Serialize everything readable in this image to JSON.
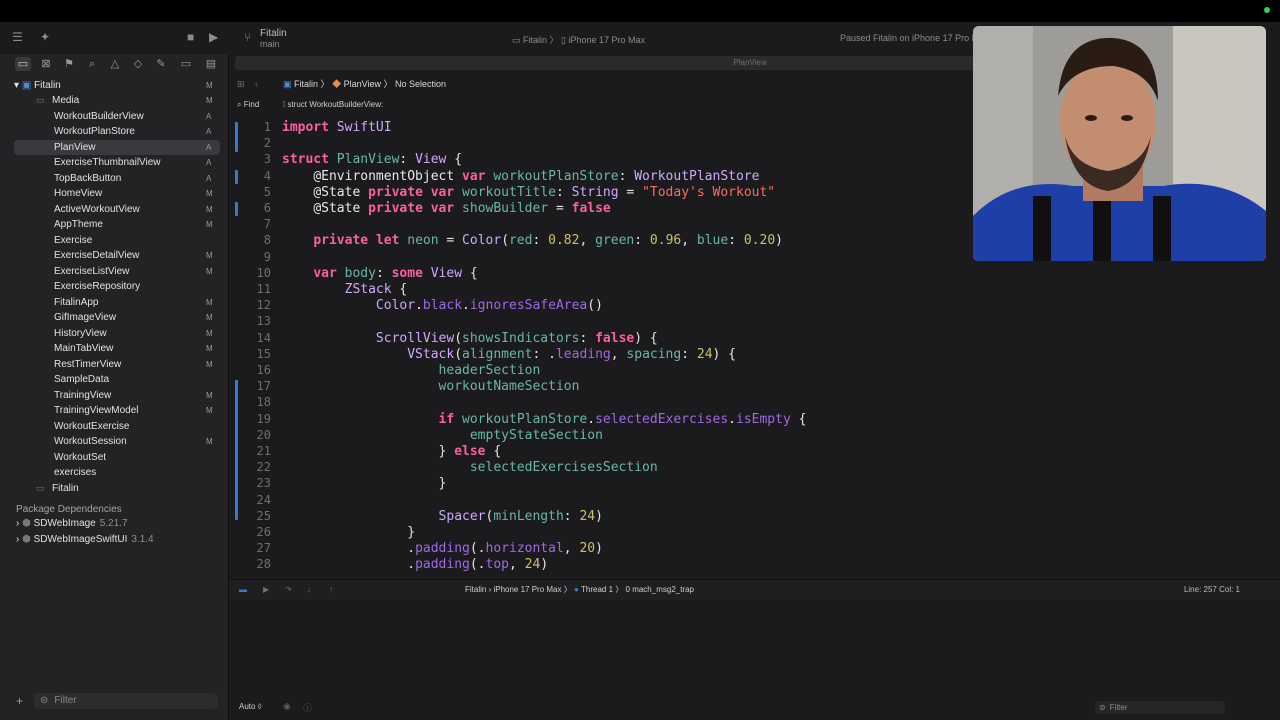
{
  "window": {
    "project_name": "Fitalin",
    "branch": "main",
    "scheme": "Fitalin",
    "device": "iPhone 17 Pro Max",
    "status": "Paused Fitalin on iPhone 17 Pro M"
  },
  "sidebar": {
    "root": {
      "name": "Fitalin",
      "status": "M"
    },
    "items": [
      {
        "name": "Media",
        "status": "M",
        "kind": "folder"
      },
      {
        "name": "WorkoutBuilderView",
        "status": "A"
      },
      {
        "name": "WorkoutPlanStore",
        "status": "A"
      },
      {
        "name": "PlanView",
        "status": "A",
        "selected": true
      },
      {
        "name": "ExerciseThumbnailView",
        "status": "A"
      },
      {
        "name": "TopBackButton",
        "status": "A"
      },
      {
        "name": "HomeView",
        "status": "M"
      },
      {
        "name": "ActiveWorkoutView",
        "status": "M"
      },
      {
        "name": "AppTheme",
        "status": "M"
      },
      {
        "name": "Exercise",
        "status": ""
      },
      {
        "name": "ExerciseDetailView",
        "status": "M"
      },
      {
        "name": "ExerciseListView",
        "status": "M"
      },
      {
        "name": "ExerciseRepository",
        "status": ""
      },
      {
        "name": "FitalinApp",
        "status": "M"
      },
      {
        "name": "GifImageView",
        "status": "M"
      },
      {
        "name": "HistoryView",
        "status": "M"
      },
      {
        "name": "MainTabView",
        "status": "M"
      },
      {
        "name": "RestTimerView",
        "status": "M"
      },
      {
        "name": "SampleData",
        "status": ""
      },
      {
        "name": "TrainingView",
        "status": "M"
      },
      {
        "name": "TrainingViewModel",
        "status": "M"
      },
      {
        "name": "WorkoutExercise",
        "status": ""
      },
      {
        "name": "WorkoutSession",
        "status": "M"
      },
      {
        "name": "WorkoutSet",
        "status": ""
      },
      {
        "name": "exercises",
        "status": ""
      },
      {
        "name": "Fitalin",
        "status": "",
        "kind": "folder"
      }
    ],
    "package_header": "Package Dependencies",
    "packages": [
      {
        "name": "SDWebImage",
        "version": "5.21.7"
      },
      {
        "name": "SDWebImageSwiftUI",
        "version": "3.1.4"
      }
    ],
    "filter_placeholder": "Filter"
  },
  "editor": {
    "tab_title": "PlanView",
    "breadcrumb": [
      "Fitalin",
      "PlanView",
      "No Selection"
    ],
    "find_label": "Find",
    "find_scope": "struct WorkoutBuilderView:",
    "code_lines": [
      {
        "n": "1",
        "text": "import SwiftUI"
      },
      {
        "n": "2",
        "text": ""
      },
      {
        "n": "3",
        "text": "struct PlanView: View {"
      },
      {
        "n": "4",
        "text": "    @EnvironmentObject var workoutPlanStore: WorkoutPlanStore"
      },
      {
        "n": "5",
        "text": "    @State private var workoutTitle: String = \"Today's Workout\""
      },
      {
        "n": "6",
        "text": "    @State private var showBuilder = false"
      },
      {
        "n": "7",
        "text": ""
      },
      {
        "n": "8",
        "text": "    private let neon = Color(red: 0.82, green: 0.96, blue: 0.20)"
      },
      {
        "n": "9",
        "text": ""
      },
      {
        "n": "10",
        "text": "    var body: some View {"
      },
      {
        "n": "11",
        "text": "        ZStack {"
      },
      {
        "n": "12",
        "text": "            Color.black.ignoresSafeArea()"
      },
      {
        "n": "13",
        "text": ""
      },
      {
        "n": "14",
        "text": "            ScrollView(showsIndicators: false) {"
      },
      {
        "n": "15",
        "text": "                VStack(alignment: .leading, spacing: 24) {"
      },
      {
        "n": "16",
        "text": "                    headerSection"
      },
      {
        "n": "17",
        "text": "                    workoutNameSection"
      },
      {
        "n": "18",
        "text": ""
      },
      {
        "n": "19",
        "text": "                    if workoutPlanStore.selectedExercises.isEmpty {"
      },
      {
        "n": "20",
        "text": "                        emptyStateSection"
      },
      {
        "n": "21",
        "text": "                    } else {"
      },
      {
        "n": "22",
        "text": "                        selectedExercisesSection"
      },
      {
        "n": "23",
        "text": "                    }"
      },
      {
        "n": "24",
        "text": ""
      },
      {
        "n": "25",
        "text": "                    Spacer(minLength: 24)"
      },
      {
        "n": "26",
        "text": "                }"
      },
      {
        "n": "27",
        "text": "                .padding(.horizontal, 20)"
      },
      {
        "n": "28",
        "text": "                .padding(.top, 24)"
      }
    ]
  },
  "debug_bar": {
    "scheme_device": "Fitalin › iPhone 17 Pro Max",
    "thread": "Thread 1",
    "frame": "0 mach_msg2_trap",
    "position": "Line: 257  Col: 1"
  },
  "console": {
    "auto_label": "Auto ◊",
    "filter_placeholder": "Filter"
  },
  "colors": {
    "accent": "#3a79d0",
    "keyword": "#fc5fa3",
    "string": "#fc6a5d",
    "number": "#d0bf69"
  }
}
